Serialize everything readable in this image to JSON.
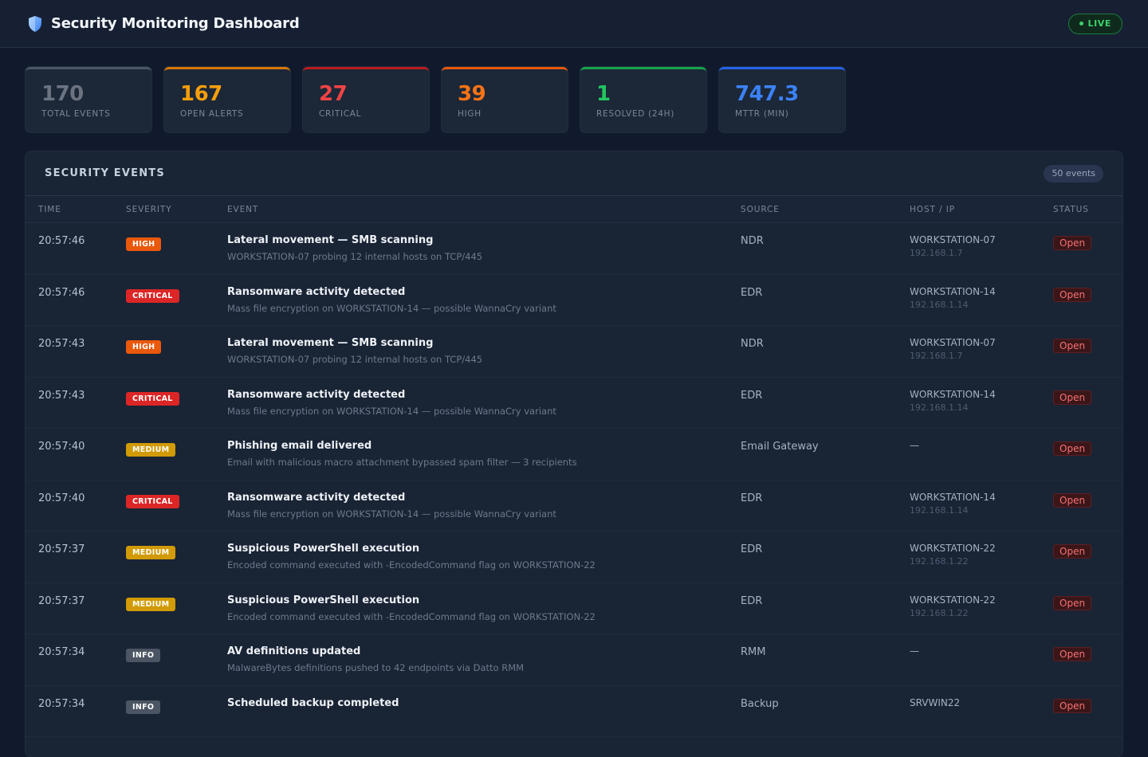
{
  "header": {
    "title": "Security Monitoring Dashboard",
    "icon": "shield-icon",
    "live_label": "LIVE"
  },
  "kpis": [
    {
      "value": "170",
      "label": "TOTAL EVENTS",
      "color": "#6b7280",
      "accent": "#4b5563"
    },
    {
      "value": "167",
      "label": "OPEN ALERTS",
      "color": "#f59e0b",
      "accent": "#d97706"
    },
    {
      "value": "27",
      "label": "CRITICAL",
      "color": "#ef4444",
      "accent": "#b91c1c"
    },
    {
      "value": "39",
      "label": "HIGH",
      "color": "#f97316",
      "accent": "#ea580c"
    },
    {
      "value": "1",
      "label": "RESOLVED (24H)",
      "color": "#22c55e",
      "accent": "#16a34a"
    },
    {
      "value": "747.3",
      "label": "MTTR (MIN)",
      "color": "#3b82f6",
      "accent": "#2563eb"
    }
  ],
  "events_panel": {
    "title": "SECURITY EVENTS",
    "count": "50 events",
    "columns": [
      "TIME",
      "SEVERITY",
      "EVENT",
      "SOURCE",
      "HOST / IP",
      "STATUS"
    ],
    "rows": [
      {
        "time": "20:57:46",
        "severity": "HIGH",
        "title": "Lateral movement — SMB scanning",
        "desc": "WORKSTATION-07 probing 12 internal hosts on TCP/445",
        "source": "NDR",
        "host": "WORKSTATION-07",
        "ip": "192.168.1.7",
        "status": "Open"
      },
      {
        "time": "20:57:46",
        "severity": "CRITICAL",
        "title": "Ransomware activity detected",
        "desc": "Mass file encryption on WORKSTATION-14 — possible WannaCry variant",
        "source": "EDR",
        "host": "WORKSTATION-14",
        "ip": "192.168.1.14",
        "status": "Open"
      },
      {
        "time": "20:57:43",
        "severity": "HIGH",
        "title": "Lateral movement — SMB scanning",
        "desc": "WORKSTATION-07 probing 12 internal hosts on TCP/445",
        "source": "NDR",
        "host": "WORKSTATION-07",
        "ip": "192.168.1.7",
        "status": "Open"
      },
      {
        "time": "20:57:43",
        "severity": "CRITICAL",
        "title": "Ransomware activity detected",
        "desc": "Mass file encryption on WORKSTATION-14 — possible WannaCry variant",
        "source": "EDR",
        "host": "WORKSTATION-14",
        "ip": "192.168.1.14",
        "status": "Open"
      },
      {
        "time": "20:57:40",
        "severity": "MEDIUM",
        "title": "Phishing email delivered",
        "desc": "Email with malicious macro attachment bypassed spam filter — 3 recipients",
        "source": "Email Gateway",
        "host": "—",
        "ip": "",
        "status": "Open"
      },
      {
        "time": "20:57:40",
        "severity": "CRITICAL",
        "title": "Ransomware activity detected",
        "desc": "Mass file encryption on WORKSTATION-14 — possible WannaCry variant",
        "source": "EDR",
        "host": "WORKSTATION-14",
        "ip": "192.168.1.14",
        "status": "Open"
      },
      {
        "time": "20:57:37",
        "severity": "MEDIUM",
        "title": "Suspicious PowerShell execution",
        "desc": "Encoded command executed with -EncodedCommand flag on WORKSTATION-22",
        "source": "EDR",
        "host": "WORKSTATION-22",
        "ip": "192.168.1.22",
        "status": "Open"
      },
      {
        "time": "20:57:37",
        "severity": "MEDIUM",
        "title": "Suspicious PowerShell execution",
        "desc": "Encoded command executed with -EncodedCommand flag on WORKSTATION-22",
        "source": "EDR",
        "host": "WORKSTATION-22",
        "ip": "192.168.1.22",
        "status": "Open"
      },
      {
        "time": "20:57:34",
        "severity": "INFO",
        "title": "AV definitions updated",
        "desc": "MalwareBytes definitions pushed to 42 endpoints via Datto RMM",
        "source": "RMM",
        "host": "—",
        "ip": "",
        "status": "Open"
      },
      {
        "time": "20:57:34",
        "severity": "INFO",
        "title": "Scheduled backup completed",
        "desc": "",
        "source": "Backup",
        "host": "SRVWIN22",
        "ip": "",
        "status": "Open"
      }
    ]
  },
  "severity_colors": {
    "HIGH": "#ea580c",
    "CRITICAL": "#dc2626",
    "MEDIUM": "#d19a06",
    "INFO": "#4b5563"
  }
}
